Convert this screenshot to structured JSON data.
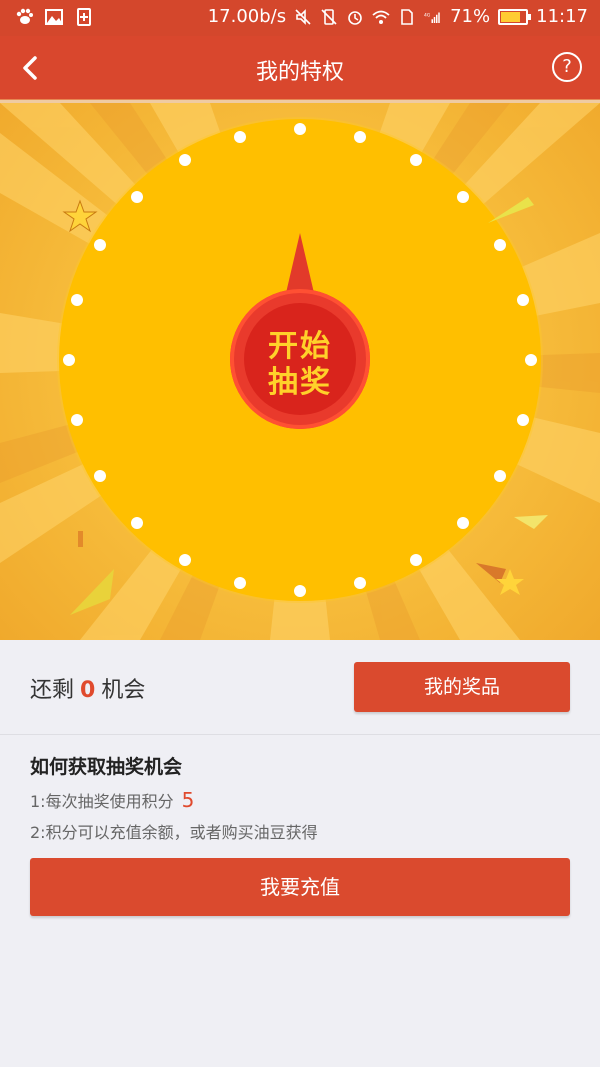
{
  "status_bar": {
    "net_speed": "17.00b/s",
    "battery_pct": "71%",
    "battery_level": 0.71,
    "time": "11:17",
    "network_type": "4G LTE",
    "icons": [
      "paw-icon",
      "image-icon",
      "sim-plus-icon",
      "mute-icon",
      "vibrate-off-icon",
      "alarm-icon",
      "wifi-icon",
      "sim-icon",
      "signal-icon",
      "battery-icon"
    ]
  },
  "navbar": {
    "title": "我的特权",
    "back_icon": "chevron-left-icon",
    "help_icon": "?"
  },
  "wheel": {
    "start_line1": "开始",
    "start_line2": "抽奖",
    "colors": {
      "wheel": "#ffbf00",
      "button": "#d9241c",
      "button_text": "#ffd12a"
    }
  },
  "chances": {
    "prefix": "还剩",
    "count": "0",
    "suffix": "机会",
    "prize_button": "我的奖品"
  },
  "howto": {
    "title": "如何获取抽奖机会",
    "line1_text": "1:每次抽奖使用积分",
    "line1_value": "5",
    "line2_text": "2:积分可以充值余额，或者购买油豆获得",
    "recharge_button": "我要充值"
  },
  "colors": {
    "accent": "#da4a2e",
    "statusbar": "#d4472c",
    "background": "#efeff4"
  }
}
